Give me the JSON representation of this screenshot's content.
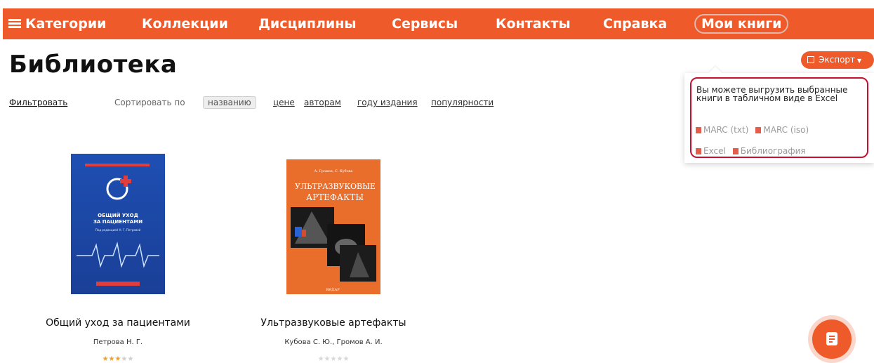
{
  "nav": {
    "items": [
      {
        "label": "Категории"
      },
      {
        "label": "Коллекции"
      },
      {
        "label": "Дисциплины"
      },
      {
        "label": "Сервисы"
      },
      {
        "label": "Контакты"
      },
      {
        "label": "Справка"
      },
      {
        "label": "Мои книги"
      }
    ]
  },
  "page": {
    "title": "Библиотека"
  },
  "export": {
    "button_label": "Экспорт",
    "panel_text": "Вы можете выгрузить выбранные книги в табличном виде в Excel",
    "links": [
      "MARC (txt)",
      "MARC (iso)",
      "Excel",
      "Библиография"
    ]
  },
  "filter": {
    "filter_label": "Фильтровать",
    "sort_label": "Сортировать по",
    "options": [
      "названию",
      "цене",
      "авторам",
      "году издания",
      "популярности"
    ],
    "active_option": "названию"
  },
  "books": [
    {
      "title": "Общий уход за пациентами",
      "author": "Петрова Н. Г.",
      "rating": 3,
      "cover_text": [
        "ОБЩИЙ УХОД",
        "ЗА ПАЦИЕНТАМИ",
        "Под редакцией Н. Г. Петровой"
      ]
    },
    {
      "title": "Ультразвуковые артефакты",
      "author": "Кубова С. Ю., Громов А. И.",
      "rating": 0,
      "cover_text": [
        "А. Громов, С. Кубова",
        "УЛЬТРАЗВУКОВЫЕ",
        "АРТЕФАКТЫ",
        "ВИДАР"
      ]
    }
  ],
  "colors": {
    "accent": "#ee5a2a",
    "highlight_border": "#c8102e"
  },
  "icons": {
    "menu": "hamburger-icon",
    "export": "external-link-icon",
    "file": "file-icon",
    "fab": "document-icon"
  }
}
